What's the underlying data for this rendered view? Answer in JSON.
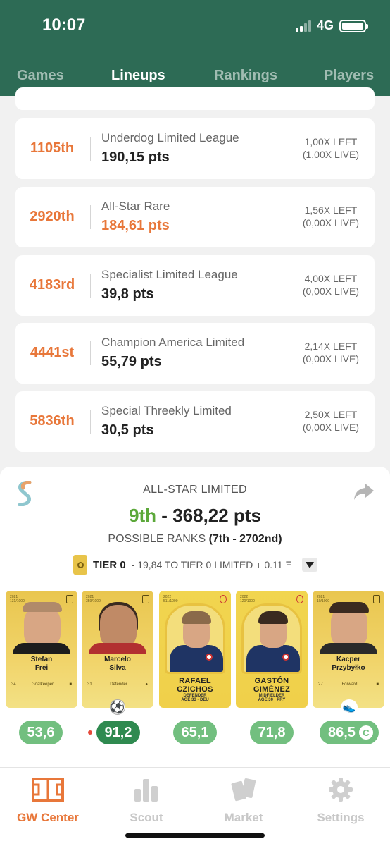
{
  "status": {
    "time": "10:07",
    "network": "4G"
  },
  "tabs": [
    {
      "label": "Games"
    },
    {
      "label": "Lineups"
    },
    {
      "label": "Rankings"
    },
    {
      "label": "Players"
    }
  ],
  "rankings": [
    {
      "rank": "1105th",
      "name": "Underdog Limited League",
      "pts": "190,15 pts",
      "left": "1,00X LEFT",
      "live": "(1,00X LIVE)"
    },
    {
      "rank": "2920th",
      "name": "All-Star Rare",
      "pts": "184,61 pts",
      "left": "1,56X LEFT",
      "live": "(0,00X LIVE)"
    },
    {
      "rank": "4183rd",
      "name": "Specialist Limited League",
      "pts": "39,8 pts",
      "left": "4,00X LEFT",
      "live": "(0,00X LIVE)"
    },
    {
      "rank": "4441st",
      "name": "Champion America Limited",
      "pts": "55,79 pts",
      "left": "2,14X LEFT",
      "live": "(0,00X LIVE)"
    },
    {
      "rank": "5836th",
      "name": "Special Threekly Limited",
      "pts": "30,5 pts",
      "left": "2,50X LEFT",
      "live": "(0,00X LIVE)"
    }
  ],
  "highlight": {
    "title": "ALL-STAR LIMITED",
    "rank": "9th",
    "pts": "368,22 pts",
    "possible_label": "POSSIBLE RANKS",
    "possible_range": "(7th - 2702nd)",
    "tier": "TIER 0",
    "tier_note": "- 19,84 TO TIER 0 LIMITED + 0.11 Ξ"
  },
  "players": [
    {
      "name1": "Stefan",
      "name2": "Frei",
      "age": "34",
      "position": "Goalkeeper",
      "serial": "131/1000",
      "season": "2021",
      "score": "53,6"
    },
    {
      "name1": "Marcelo",
      "name2": "Silva",
      "age": "31",
      "position": "Defender",
      "serial": "359/1000",
      "season": "2021",
      "score": "91,2"
    },
    {
      "name1": "RAFAEL",
      "name2": "CZICHOS",
      "position": "DEFENDER",
      "sub": "AGE 33 · DEU",
      "season": "2022",
      "serial": "511/1000",
      "score": "65,1"
    },
    {
      "name1": "GASTÓN",
      "name2": "GIMÉNEZ",
      "position": "MIDFIELDER",
      "sub": "AGE 30 · PRY",
      "season": "2022",
      "serial": "120/1000",
      "score": "71,8"
    },
    {
      "name1": "Kacper",
      "name2": "Przybyłko",
      "age": "27",
      "position": "Forward",
      "serial": "10/1000",
      "season": "2021",
      "score": "86,5",
      "captain": "C"
    }
  ],
  "nav": [
    {
      "label": "GW Center",
      "icon": "pitch-icon"
    },
    {
      "label": "Scout",
      "icon": "bar-chart-icon"
    },
    {
      "label": "Market",
      "icon": "cards-icon"
    },
    {
      "label": "Settings",
      "icon": "gear-icon"
    }
  ],
  "colors": {
    "header": "#2d6b55",
    "accent": "#e8773a",
    "score_green": "#72bf7f",
    "rank_green": "#5ca83a"
  }
}
